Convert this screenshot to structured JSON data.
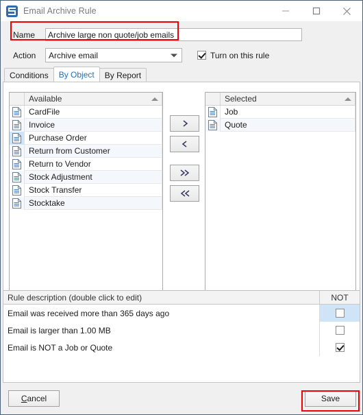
{
  "window": {
    "title": "Email Archive Rule",
    "icon": "email-app-icon",
    "controls": {
      "minimize": "minimize-icon",
      "maximize": "maximize-icon",
      "close": "close-icon"
    }
  },
  "form": {
    "name_label": "Name",
    "name_value": "Archive large non quote/job emails",
    "name_placeholder": "",
    "action_label": "Action",
    "action_value": "Archive email",
    "enable_checkbox_label": "Turn on this rule",
    "enable_checkbox_checked": true
  },
  "tabs": [
    {
      "label": "Conditions",
      "active": false
    },
    {
      "label": "By Object",
      "active": true
    },
    {
      "label": "By Report",
      "active": false
    }
  ],
  "available_list": {
    "header": "Available",
    "sort": "ascending",
    "items": [
      {
        "label": "CardFile",
        "selected": false
      },
      {
        "label": "Invoice",
        "selected": false
      },
      {
        "label": "Purchase Order",
        "selected": true
      },
      {
        "label": "Return from Customer",
        "selected": false
      },
      {
        "label": "Return to Vendor",
        "selected": false
      },
      {
        "label": "Stock Adjustment",
        "selected": false
      },
      {
        "label": "Stock Transfer",
        "selected": false
      },
      {
        "label": "Stocktake",
        "selected": false
      }
    ]
  },
  "selected_list": {
    "header": "Selected",
    "sort": "ascending",
    "items": [
      {
        "label": "Job",
        "selected": false
      },
      {
        "label": "Quote",
        "selected": false
      }
    ]
  },
  "transfer_buttons": [
    {
      "label": ">",
      "name": "move-right-button"
    },
    {
      "label": "<",
      "name": "move-left-button"
    },
    {
      "label": ">>",
      "name": "move-all-right-button"
    },
    {
      "label": "<<",
      "name": "move-all-left-button"
    }
  ],
  "rule_description": {
    "header": "Rule description (double click to edit)",
    "not_header": "NOT",
    "rows": [
      {
        "text": "Email was received more than 365 days ago",
        "not_checked": false,
        "highlighted": true
      },
      {
        "text": "Email is larger than 1.00 MB",
        "not_checked": false,
        "highlighted": false
      },
      {
        "text": "Email is NOT a Job or Quote",
        "not_checked": true,
        "highlighted": false
      }
    ]
  },
  "footer": {
    "cancel_label": "Cancel",
    "cancel_accel": "C",
    "cancel_rest": "ancel",
    "save_label": "Save"
  },
  "annotations": {
    "highlight_color": "#ee0000",
    "boxes": [
      "name-field-highlight",
      "save-button-highlight"
    ]
  },
  "colors": {
    "accent": "#1e6fbe",
    "selection": "#cfe4f7",
    "alt_row": "#f4f7fb",
    "window_border": "#4a6179"
  }
}
